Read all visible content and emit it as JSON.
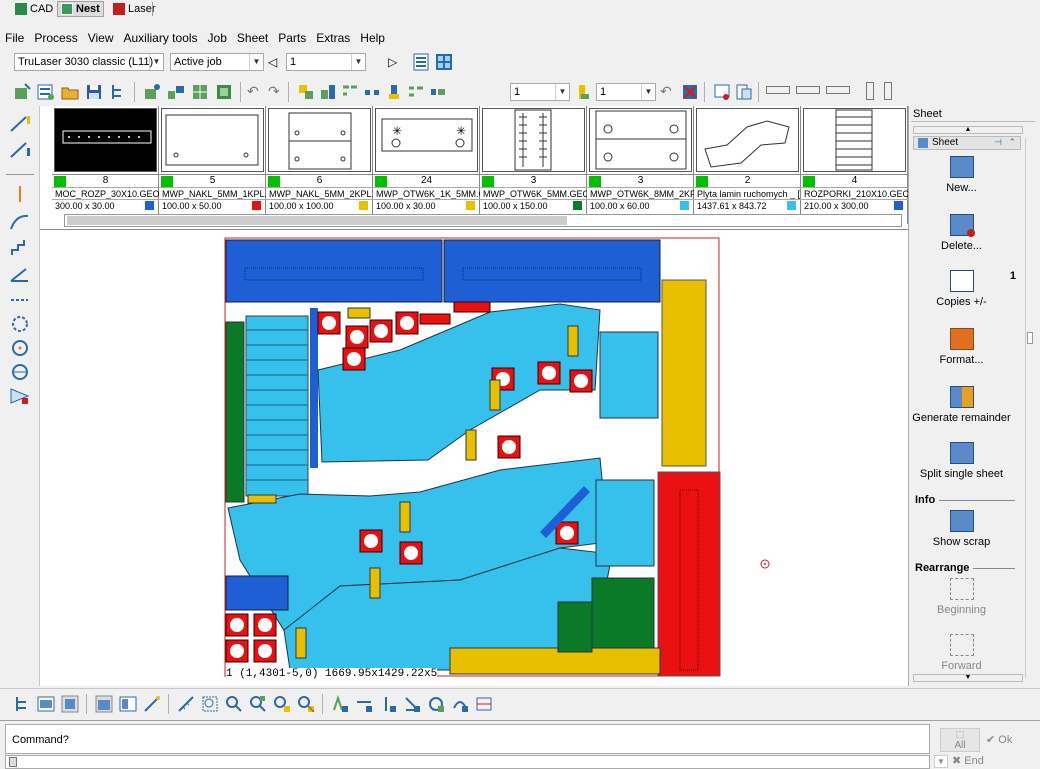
{
  "mode_tabs": [
    {
      "label": "CAD",
      "icon": "cad-icon",
      "active": false
    },
    {
      "label": "Nest",
      "icon": "nest-icon",
      "active": true
    },
    {
      "label": "Laser",
      "icon": "laser-icon",
      "active": false
    }
  ],
  "menu": [
    "File",
    "Process",
    "View",
    "Auxiliary tools",
    "Job",
    "Sheet",
    "Parts",
    "Extras",
    "Help"
  ],
  "machine_toolbar": {
    "machine": "TruLaser 3030 classic (L11)",
    "job": "Active job",
    "sheet_number": "1"
  },
  "main_toolbar": {
    "quantity_1": "1",
    "quantity_2": "1"
  },
  "parts": [
    {
      "count": "8",
      "name": "MOC_ROZP_30X10.GEO",
      "dims": "300.00 x 30.00",
      "color": "#1f5fd6"
    },
    {
      "count": "5",
      "name": "MWP_NAKL_5MM_1KPL.",
      "dims": "100.00 x 50.00",
      "color": "#e81010"
    },
    {
      "count": "6",
      "name": "MWP_NAKL_5MM_2KPL.",
      "dims": "100.00 x 100.00",
      "color": "#e8c000"
    },
    {
      "count": "24",
      "name": "MWP_OTW6K_1K_5MM.G",
      "dims": "100.00 x 30.00",
      "color": "#e8c000"
    },
    {
      "count": "3",
      "name": "MWP_OTW6K_5MM.GEO",
      "dims": "100.00 x 150.00",
      "color": "#0a7a28"
    },
    {
      "count": "3",
      "name": "MWP_OTW6K_8MM_2KP",
      "dims": "100.00 x 60.00",
      "color": "#35c1ec"
    },
    {
      "count": "2",
      "name": "Plyta lamin ruchomych _ [",
      "dims": "1437.61 x 843.72",
      "color": "#35c1ec"
    },
    {
      "count": "4",
      "name": "ROZPORKI_210X10.GEO",
      "dims": "210.00 x 300.00",
      "color": "#1f5fd6"
    }
  ],
  "canvas": {
    "status_text": "1 (1,4301-5,0)   1669.95x1429.22x5"
  },
  "right_panel": {
    "title": "Sheet",
    "tab": "Sheet",
    "items": {
      "new": "New...",
      "delete": "Delete...",
      "copies": "Copies +/-",
      "copies_count": "1",
      "format": "Format...",
      "remainder": "Generate remainder",
      "split": "Split single sheet",
      "show_scrap": "Show scrap",
      "beginning": "Beginning",
      "forward": "Forward"
    },
    "groups": {
      "info": "Info",
      "rearrange": "Rearrange"
    }
  },
  "command": {
    "prompt": "Command?",
    "all_label": "All",
    "ok_label": "Ok",
    "end_label": "End"
  },
  "colors": {
    "blue": "#1f5fd6",
    "red": "#e81010",
    "yellow": "#e8c000",
    "green": "#0a7a28",
    "cyan": "#35c1ec"
  }
}
